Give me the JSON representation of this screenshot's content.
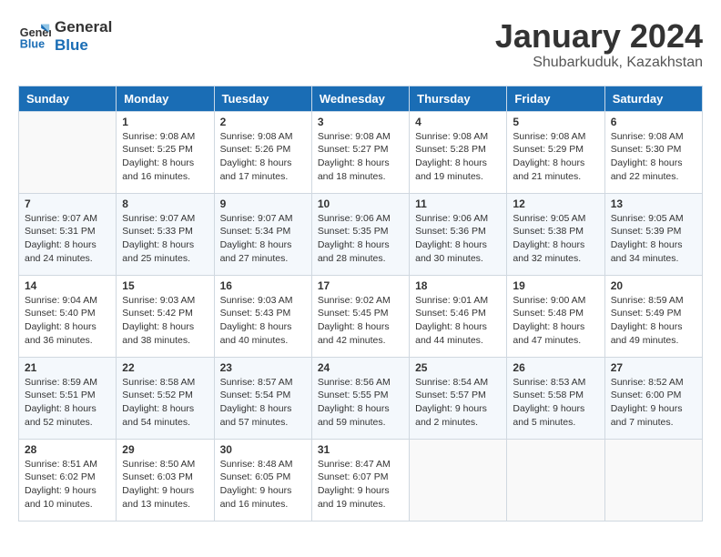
{
  "header": {
    "logo_line1": "General",
    "logo_line2": "Blue",
    "month": "January 2024",
    "location": "Shubarkuduk, Kazakhstan"
  },
  "days_of_week": [
    "Sunday",
    "Monday",
    "Tuesday",
    "Wednesday",
    "Thursday",
    "Friday",
    "Saturday"
  ],
  "weeks": [
    [
      {
        "day": "",
        "content": ""
      },
      {
        "day": "1",
        "content": "Sunrise: 9:08 AM\nSunset: 5:25 PM\nDaylight: 8 hours\nand 16 minutes."
      },
      {
        "day": "2",
        "content": "Sunrise: 9:08 AM\nSunset: 5:26 PM\nDaylight: 8 hours\nand 17 minutes."
      },
      {
        "day": "3",
        "content": "Sunrise: 9:08 AM\nSunset: 5:27 PM\nDaylight: 8 hours\nand 18 minutes."
      },
      {
        "day": "4",
        "content": "Sunrise: 9:08 AM\nSunset: 5:28 PM\nDaylight: 8 hours\nand 19 minutes."
      },
      {
        "day": "5",
        "content": "Sunrise: 9:08 AM\nSunset: 5:29 PM\nDaylight: 8 hours\nand 21 minutes."
      },
      {
        "day": "6",
        "content": "Sunrise: 9:08 AM\nSunset: 5:30 PM\nDaylight: 8 hours\nand 22 minutes."
      }
    ],
    [
      {
        "day": "7",
        "content": "Sunrise: 9:07 AM\nSunset: 5:31 PM\nDaylight: 8 hours\nand 24 minutes."
      },
      {
        "day": "8",
        "content": "Sunrise: 9:07 AM\nSunset: 5:33 PM\nDaylight: 8 hours\nand 25 minutes."
      },
      {
        "day": "9",
        "content": "Sunrise: 9:07 AM\nSunset: 5:34 PM\nDaylight: 8 hours\nand 27 minutes."
      },
      {
        "day": "10",
        "content": "Sunrise: 9:06 AM\nSunset: 5:35 PM\nDaylight: 8 hours\nand 28 minutes."
      },
      {
        "day": "11",
        "content": "Sunrise: 9:06 AM\nSunset: 5:36 PM\nDaylight: 8 hours\nand 30 minutes."
      },
      {
        "day": "12",
        "content": "Sunrise: 9:05 AM\nSunset: 5:38 PM\nDaylight: 8 hours\nand 32 minutes."
      },
      {
        "day": "13",
        "content": "Sunrise: 9:05 AM\nSunset: 5:39 PM\nDaylight: 8 hours\nand 34 minutes."
      }
    ],
    [
      {
        "day": "14",
        "content": "Sunrise: 9:04 AM\nSunset: 5:40 PM\nDaylight: 8 hours\nand 36 minutes."
      },
      {
        "day": "15",
        "content": "Sunrise: 9:03 AM\nSunset: 5:42 PM\nDaylight: 8 hours\nand 38 minutes."
      },
      {
        "day": "16",
        "content": "Sunrise: 9:03 AM\nSunset: 5:43 PM\nDaylight: 8 hours\nand 40 minutes."
      },
      {
        "day": "17",
        "content": "Sunrise: 9:02 AM\nSunset: 5:45 PM\nDaylight: 8 hours\nand 42 minutes."
      },
      {
        "day": "18",
        "content": "Sunrise: 9:01 AM\nSunset: 5:46 PM\nDaylight: 8 hours\nand 44 minutes."
      },
      {
        "day": "19",
        "content": "Sunrise: 9:00 AM\nSunset: 5:48 PM\nDaylight: 8 hours\nand 47 minutes."
      },
      {
        "day": "20",
        "content": "Sunrise: 8:59 AM\nSunset: 5:49 PM\nDaylight: 8 hours\nand 49 minutes."
      }
    ],
    [
      {
        "day": "21",
        "content": "Sunrise: 8:59 AM\nSunset: 5:51 PM\nDaylight: 8 hours\nand 52 minutes."
      },
      {
        "day": "22",
        "content": "Sunrise: 8:58 AM\nSunset: 5:52 PM\nDaylight: 8 hours\nand 54 minutes."
      },
      {
        "day": "23",
        "content": "Sunrise: 8:57 AM\nSunset: 5:54 PM\nDaylight: 8 hours\nand 57 minutes."
      },
      {
        "day": "24",
        "content": "Sunrise: 8:56 AM\nSunset: 5:55 PM\nDaylight: 8 hours\nand 59 minutes."
      },
      {
        "day": "25",
        "content": "Sunrise: 8:54 AM\nSunset: 5:57 PM\nDaylight: 9 hours\nand 2 minutes."
      },
      {
        "day": "26",
        "content": "Sunrise: 8:53 AM\nSunset: 5:58 PM\nDaylight: 9 hours\nand 5 minutes."
      },
      {
        "day": "27",
        "content": "Sunrise: 8:52 AM\nSunset: 6:00 PM\nDaylight: 9 hours\nand 7 minutes."
      }
    ],
    [
      {
        "day": "28",
        "content": "Sunrise: 8:51 AM\nSunset: 6:02 PM\nDaylight: 9 hours\nand 10 minutes."
      },
      {
        "day": "29",
        "content": "Sunrise: 8:50 AM\nSunset: 6:03 PM\nDaylight: 9 hours\nand 13 minutes."
      },
      {
        "day": "30",
        "content": "Sunrise: 8:48 AM\nSunset: 6:05 PM\nDaylight: 9 hours\nand 16 minutes."
      },
      {
        "day": "31",
        "content": "Sunrise: 8:47 AM\nSunset: 6:07 PM\nDaylight: 9 hours\nand 19 minutes."
      },
      {
        "day": "",
        "content": ""
      },
      {
        "day": "",
        "content": ""
      },
      {
        "day": "",
        "content": ""
      }
    ]
  ]
}
